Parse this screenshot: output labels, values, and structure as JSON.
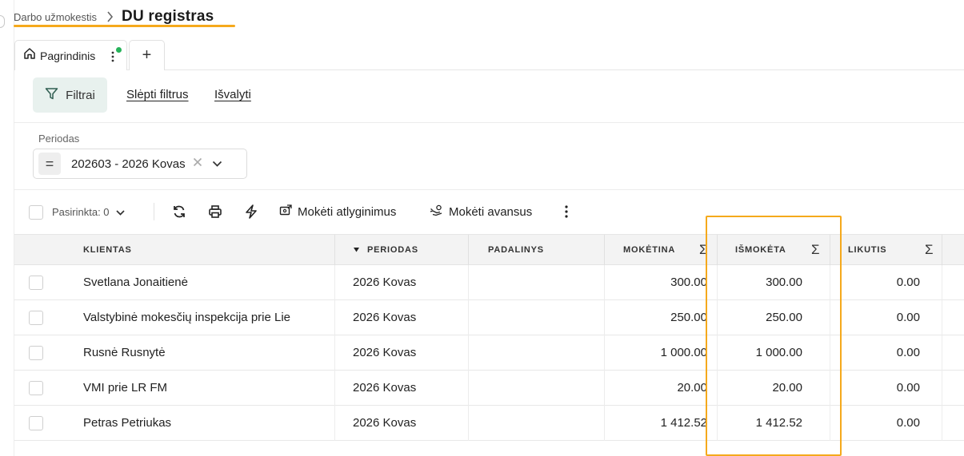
{
  "breadcrumb": {
    "parent": "Darbo užmokestis",
    "title": "DU registras"
  },
  "tabs": {
    "main_label": "Pagrindinis",
    "add_label": "+"
  },
  "filters": {
    "filters_button": "Filtrai",
    "hide_filters": "Slėpti filtrus",
    "clear": "Išvalyti"
  },
  "period": {
    "label": "Periodas",
    "operator": "=",
    "value": "202603 - 2026 Kovas"
  },
  "toolbar": {
    "selected": "Pasirinkta: 0",
    "pay_salaries": "Mokėti atlyginimus",
    "pay_advances": "Mokėti avansus"
  },
  "grid": {
    "columns": {
      "client": "KLIENTAS",
      "period": "PERIODAS",
      "unit": "PADALINYS",
      "payable": "MOKĖTINA",
      "paid": "IŠMOKĖTA",
      "balance": "LIKUTIS",
      "sum_symbol": "Σ"
    },
    "rows": [
      {
        "client": "Svetlana Jonaitienė",
        "period": "2026 Kovas",
        "unit": "",
        "payable": "300.00",
        "paid": "300.00",
        "balance": "0.00"
      },
      {
        "client": "Valstybinė mokesčių inspekcija prie Lie",
        "period": "2026 Kovas",
        "unit": "",
        "payable": "250.00",
        "paid": "250.00",
        "balance": "0.00"
      },
      {
        "client": "Rusnė Rusnytė",
        "period": "2026 Kovas",
        "unit": "",
        "payable": "1 000.00",
        "paid": "1 000.00",
        "balance": "0.00"
      },
      {
        "client": "VMI prie LR FM",
        "period": "2026 Kovas",
        "unit": "",
        "payable": "20.00",
        "paid": "20.00",
        "balance": "0.00"
      },
      {
        "client": "Petras Petriukas",
        "period": "2026 Kovas",
        "unit": "",
        "payable": "1 412.52",
        "paid": "1 412.52",
        "balance": "0.00"
      }
    ]
  },
  "colors": {
    "accent_underline": "#f5a91c",
    "filter_button_bg": "#e8f1ee",
    "status_dot": "#26b35a",
    "header_bg": "#f3f3f3"
  }
}
